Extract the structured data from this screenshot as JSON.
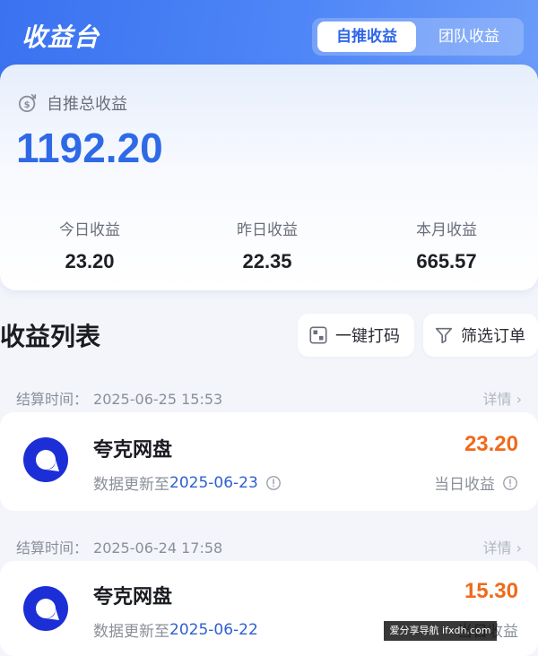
{
  "header": {
    "title": "收益台",
    "tabs": [
      {
        "label": "自推收益",
        "active": true
      },
      {
        "label": "团队收益",
        "active": false
      }
    ],
    "accent_color": "#3a72f0"
  },
  "summary": {
    "total_label": "自推总收益",
    "total_value": "1192.20",
    "stats": [
      {
        "label": "今日收益",
        "value": "23.20"
      },
      {
        "label": "昨日收益",
        "value": "22.35"
      },
      {
        "label": "本月收益",
        "value": "665.57"
      }
    ],
    "icon": "coin-icon"
  },
  "list": {
    "title": "收益列表",
    "code_button": "一键打码",
    "filter_button": "筛选订单",
    "records": [
      {
        "settle_label": "结算时间：",
        "settle_time": "2025-06-25 15:53",
        "detail": "详情 ›",
        "app_name": "夸克网盘",
        "update_prefix": "数据更新至",
        "update_date": "2025-06-23",
        "amount": "23.20",
        "amount_label": "当日收益"
      },
      {
        "settle_label": "结算时间：",
        "settle_time": "2025-06-24 17:58",
        "detail": "详情 ›",
        "app_name": "夸克网盘",
        "update_prefix": "数据更新至",
        "update_date": "2025-06-22",
        "amount": "15.30",
        "amount_label": "当日收益"
      }
    ],
    "amount_color": "#ef6a1a"
  },
  "watermark": "爱分享导航 ifxdh.com"
}
